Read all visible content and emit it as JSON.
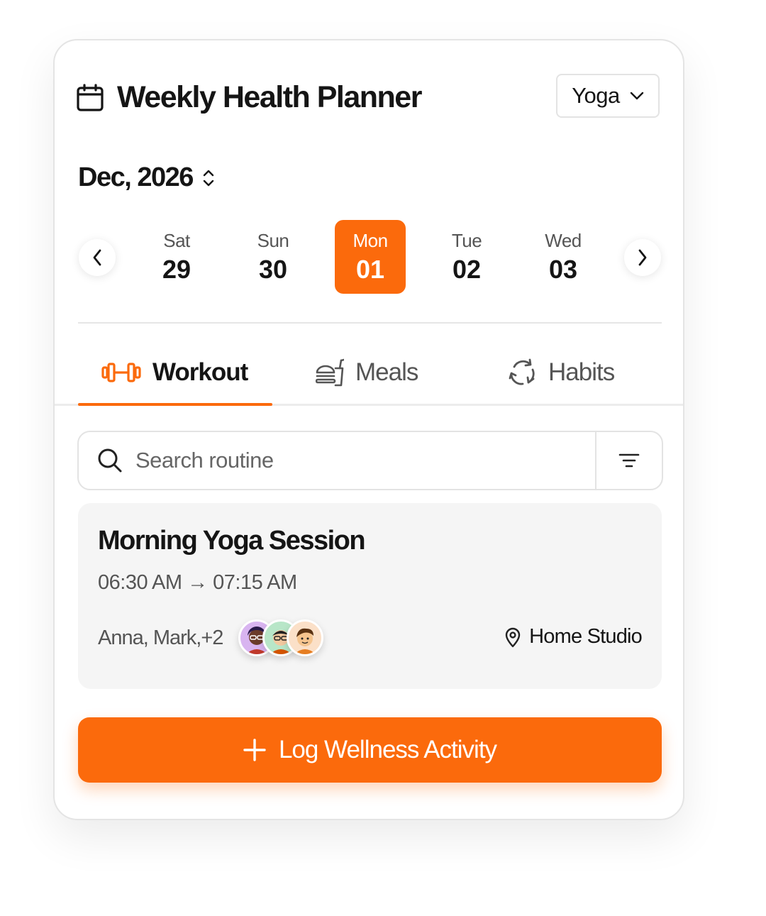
{
  "header": {
    "title": "Weekly Health Planner",
    "category_select": "Yoga"
  },
  "calendar": {
    "month_label": "Dec, 2026",
    "days": [
      {
        "name": "Sat",
        "date": "29"
      },
      {
        "name": "Sun",
        "date": "30"
      },
      {
        "name": "Mon",
        "date": "01"
      },
      {
        "name": "Tue",
        "date": "02"
      },
      {
        "name": "Wed",
        "date": "03"
      }
    ],
    "selected_day": "Mon 01"
  },
  "tabs": [
    {
      "label": "Workout",
      "icon": "dumbbell-icon"
    },
    {
      "label": "Meals",
      "icon": "burger-drink-icon"
    },
    {
      "label": "Habits",
      "icon": "cycle-arrows-icon"
    }
  ],
  "active_tab": "Workout",
  "search": {
    "placeholder": "Search routine"
  },
  "event": {
    "title": "Morning Yoga Session",
    "time": "06:30 AM → 07:15 AM",
    "participants": "Anna, Mark,+2",
    "location": "Home Studio"
  },
  "cta": {
    "label": "Log Wellness Activity"
  },
  "colors": {
    "accent": "#fb6a0c",
    "text_primary": "#151515",
    "text_secondary": "#555555",
    "card_bg": "#f5f5f5"
  }
}
